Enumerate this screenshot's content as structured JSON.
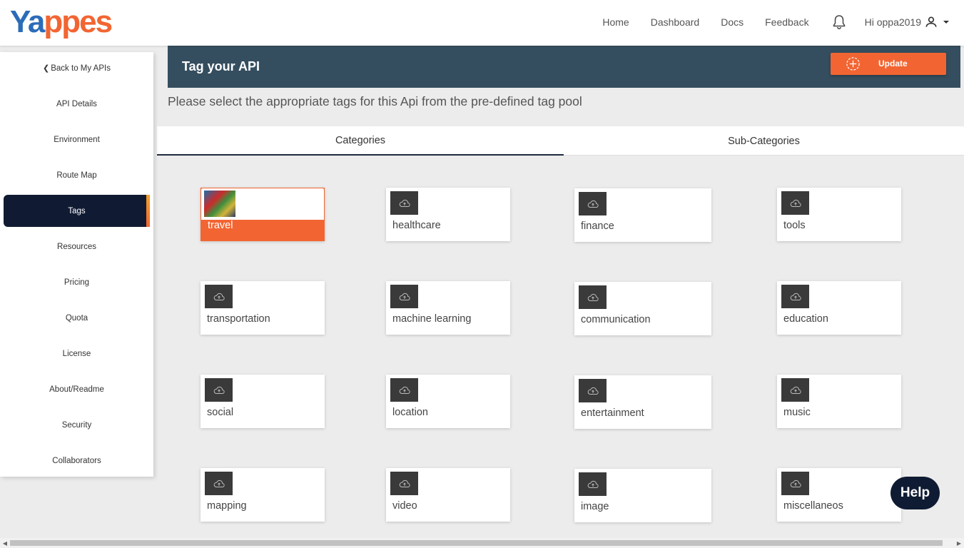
{
  "brand": {
    "logo_part1": "Ya",
    "logo_part2": "pp",
    "logo_part3": "es",
    "colors": {
      "primary": "#f26532",
      "blue": "#2b6cb8",
      "navy": "#101b33",
      "titlebar": "#354e5f"
    }
  },
  "nav": {
    "home": "Home",
    "dashboard": "Dashboard",
    "docs": "Docs",
    "feedback": "Feedback",
    "greeting": "Hi oppa2019"
  },
  "sidebar": {
    "back": "Back to My APIs",
    "items": [
      "API Details",
      "Environment",
      "Route Map",
      "Tags",
      "Resources",
      "Pricing",
      "Quota",
      "License",
      "About/Readme",
      "Security",
      "Collaborators"
    ],
    "active": "Tags"
  },
  "main": {
    "title": "Tag your API",
    "update_label": "Update",
    "subtitle": "Please select the appropriate tags for this Api from the pre-defined tag pool",
    "tabs": [
      "Categories",
      "Sub-Categories"
    ],
    "active_tab": "Categories"
  },
  "tags": [
    "travel",
    "healthcare",
    "finance",
    "tools",
    "transportation",
    "machine learning",
    "communication",
    "education",
    "social",
    "location",
    "entertainment",
    "music",
    "mapping",
    "video",
    "image",
    "miscellaneos"
  ],
  "selected_tag": "travel",
  "help_label": "Help"
}
